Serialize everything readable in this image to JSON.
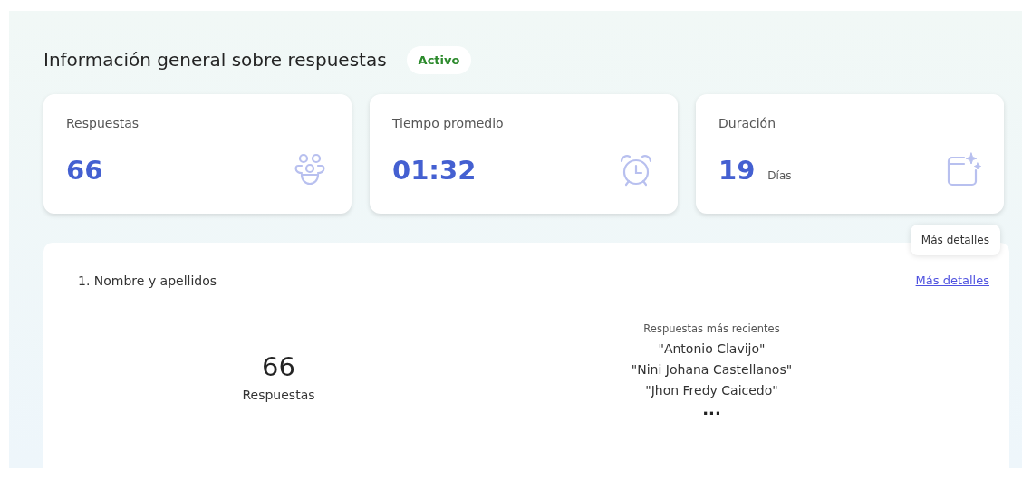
{
  "title": "Información general sobre respuestas",
  "status": "Activo",
  "stats": [
    {
      "label": "Respuestas",
      "value": "66",
      "kind": "people"
    },
    {
      "label": "Tiempo promedio",
      "value": "01:32",
      "kind": "alarm"
    },
    {
      "label": "Duración",
      "value": "19",
      "unit": "Días",
      "kind": "calendar"
    }
  ],
  "question": {
    "title": "1. Nombre y apellidos",
    "link": "Más detalles",
    "tooltip": "Más detalles",
    "count": "66",
    "count_label": "Respuestas",
    "recent_heading": "Respuestas más recientes",
    "recent": [
      "\"Antonio Clavijo\"",
      "\"Nini Johana Castellanos\"",
      "\"Jhon Fredy Caicedo\""
    ],
    "more": "..."
  }
}
